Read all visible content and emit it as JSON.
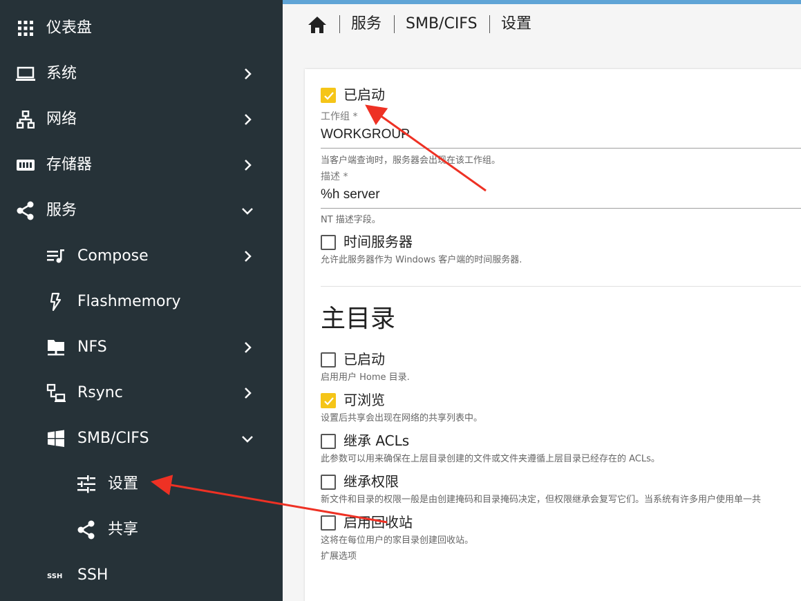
{
  "sidebar": {
    "items": [
      {
        "label": "仪表盘",
        "icon": "grid-icon"
      },
      {
        "label": "系统",
        "icon": "laptop-icon"
      },
      {
        "label": "网络",
        "icon": "network-icon"
      },
      {
        "label": "存储器",
        "icon": "storage-icon"
      },
      {
        "label": "服务",
        "icon": "share-icon"
      },
      {
        "label": "Compose",
        "icon": "playlist-music-icon"
      },
      {
        "label": "Flashmemory",
        "icon": "flash-icon"
      },
      {
        "label": "NFS",
        "icon": "folder-network-icon"
      },
      {
        "label": "Rsync",
        "icon": "lan-connect-icon"
      },
      {
        "label": "SMB/CIFS",
        "icon": "windows-icon"
      },
      {
        "label": "设置",
        "icon": "tune-icon"
      },
      {
        "label": "共享",
        "icon": "share-icon"
      },
      {
        "label": "SSH",
        "icon": "ssh-icon"
      }
    ]
  },
  "breadcrumb": {
    "items": [
      "服务",
      "SMB/CIFS",
      "设置"
    ]
  },
  "form": {
    "enabled": {
      "label": "已启动",
      "checked": true
    },
    "workgroup": {
      "label": "工作组 *",
      "value": "WORKGROUP",
      "hint": "当客户端查询时，服务器会出现在该工作组。"
    },
    "description": {
      "label": "描述 *",
      "value": "%h server",
      "hint": "NT 描述字段。"
    },
    "timeserver": {
      "label": "时间服务器",
      "checked": false,
      "hint": "允许此服务器作为 Windows 客户端的时间服务器."
    }
  },
  "homes": {
    "title": "主目录",
    "enabled": {
      "label": "已启动",
      "checked": false,
      "hint": "启用用户 Home 目录."
    },
    "browseable": {
      "label": "可浏览",
      "checked": true,
      "hint": "设置后共享会出现在网络的共享列表中。"
    },
    "inherit_acls": {
      "label": "继承 ACLs",
      "checked": false,
      "hint": "此参数可以用来确保在上层目录创建的文件或文件夹遵循上层目录已经存在的 ACLs。"
    },
    "inherit_permissions": {
      "label": "继承权限",
      "checked": false,
      "hint": "新文件和目录的权限一般是由创建掩码和目录掩码决定，但权限继承会复写它们。当系统有许多用户使用单一共"
    },
    "recycle_bin": {
      "label": "启用回收站",
      "checked": false,
      "hint": "这将在每位用户的家目录创建回收站。"
    },
    "extra_options": {
      "label": "扩展选项"
    }
  },
  "colors": {
    "sidebar_bg": "#263238",
    "accent_yellow": "#f5c518",
    "top_line": "#5fa4d6",
    "annotation_arrow": "#ee3124"
  }
}
